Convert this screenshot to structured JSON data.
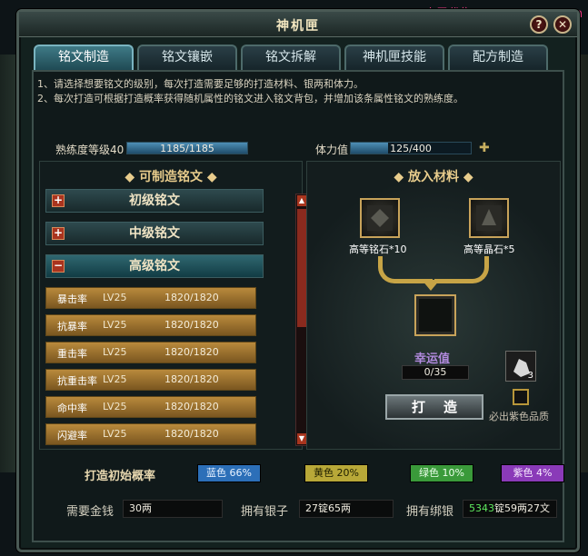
{
  "watermark": "小雪代售www.xxds777.com",
  "window": {
    "title": "神机匣",
    "help_label": "?",
    "close_label": "✕"
  },
  "tabs": [
    {
      "label": "铭文制造",
      "active": true
    },
    {
      "label": "铭文镶嵌",
      "active": false
    },
    {
      "label": "铭文拆解",
      "active": false
    },
    {
      "label": "神机匣技能",
      "active": false
    },
    {
      "label": "配方制造",
      "active": false
    }
  ],
  "notes": {
    "line1": "1、请选择想要铭文的级别，每次打造需要足够的打造材料、银两和体力。",
    "line2": "2、每次打造可根据打造概率获得随机属性的铭文进入铭文背包，并增加该条属性铭文的熟练度。"
  },
  "stats": {
    "proficiency_label": "熟练度等级40",
    "proficiency_value": "1185/1185",
    "proficiency_fraction": 1.0,
    "stamina_label": "体力值",
    "stamina_value": "125/400",
    "stamina_fraction": 0.3125
  },
  "left_panel": {
    "title": "◆ 可制造铭文 ◆",
    "categories": [
      {
        "label": "初级铭文",
        "icon": "+"
      },
      {
        "label": "中级铭文",
        "icon": "+"
      },
      {
        "label": "高级铭文",
        "icon": "−"
      }
    ],
    "runes": [
      {
        "name": "暴击率",
        "level": "LV25",
        "progress": "1820/1820"
      },
      {
        "name": "抗暴率",
        "level": "LV25",
        "progress": "1820/1820"
      },
      {
        "name": "重击率",
        "level": "LV25",
        "progress": "1820/1820"
      },
      {
        "name": "抗重击率",
        "level": "LV25",
        "progress": "1820/1820"
      },
      {
        "name": "命中率",
        "level": "LV25",
        "progress": "1820/1820"
      },
      {
        "name": "闪避率",
        "level": "LV25",
        "progress": "1820/1820"
      }
    ]
  },
  "right_panel": {
    "title": "◆ 放入材料 ◆",
    "material_1": "高等铭石*10",
    "material_2": "高等晶石*5",
    "lucky_label": "幸运值",
    "lucky_value": "0/35",
    "forge_label": "打造",
    "stone_count": "3",
    "purple_label": "必出紫色品质"
  },
  "chance": {
    "label": "打造初始概率",
    "items": [
      {
        "label": "蓝色 66%",
        "bg": "#2c6fb8",
        "color": "#e8f2ff"
      },
      {
        "label": "黄色 20%",
        "bg": "#b8a838",
        "color": "#202000"
      },
      {
        "label": "绿色 10%",
        "bg": "#3a9a3a",
        "color": "#ecffec"
      },
      {
        "label": "紫色 4%",
        "bg": "#8a3ab8",
        "color": "#f8ecff"
      }
    ]
  },
  "money": {
    "cost_label": "需要金钱",
    "cost_value": "30两",
    "silver_label": "拥有银子",
    "silver_value": "27锭65两",
    "bound_label": "拥有绑银",
    "bound_value_prefix": "5343",
    "bound_value_suffix": "锭59两27文"
  }
}
